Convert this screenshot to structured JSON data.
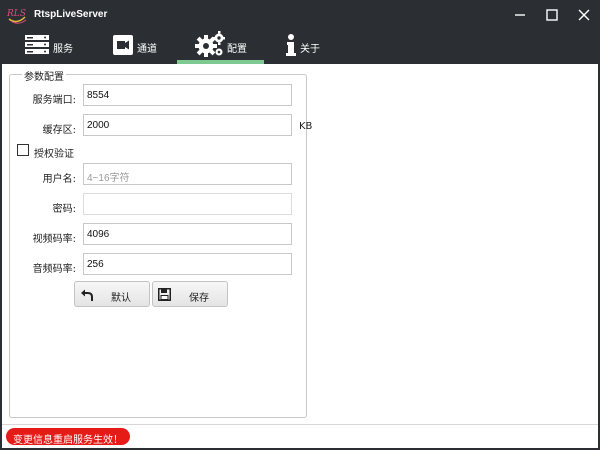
{
  "app": {
    "title": "RtspLiveServer"
  },
  "nav": {
    "tabs": [
      {
        "id": "service",
        "label": "服务",
        "icon": "server-icon"
      },
      {
        "id": "channel",
        "label": "通道",
        "icon": "video-camera-icon"
      },
      {
        "id": "config",
        "label": "配置",
        "icon": "gears-icon",
        "active": true
      },
      {
        "id": "about",
        "label": "关于",
        "icon": "info-icon"
      }
    ],
    "active_color": "#7ec98f"
  },
  "config": {
    "group_title": "参数配置",
    "port": {
      "label": "服务端口:",
      "value": "8554"
    },
    "cache": {
      "label": "缓存区:",
      "value": "2000",
      "unit": "KB"
    },
    "auth": {
      "label": "授权验证",
      "checked": false
    },
    "username": {
      "label": "用户名:",
      "placeholder": "4~16字符",
      "value": ""
    },
    "password": {
      "label": "密码:",
      "value": ""
    },
    "video_bitrate": {
      "label": "视频码率:",
      "value": "4096"
    },
    "audio_bitrate": {
      "label": "音频码率:",
      "value": "256"
    },
    "buttons": {
      "default_label": "默认",
      "save_label": "保存"
    }
  },
  "status": {
    "message": "变更信息重启服务生效！",
    "color": "#e41b17"
  }
}
